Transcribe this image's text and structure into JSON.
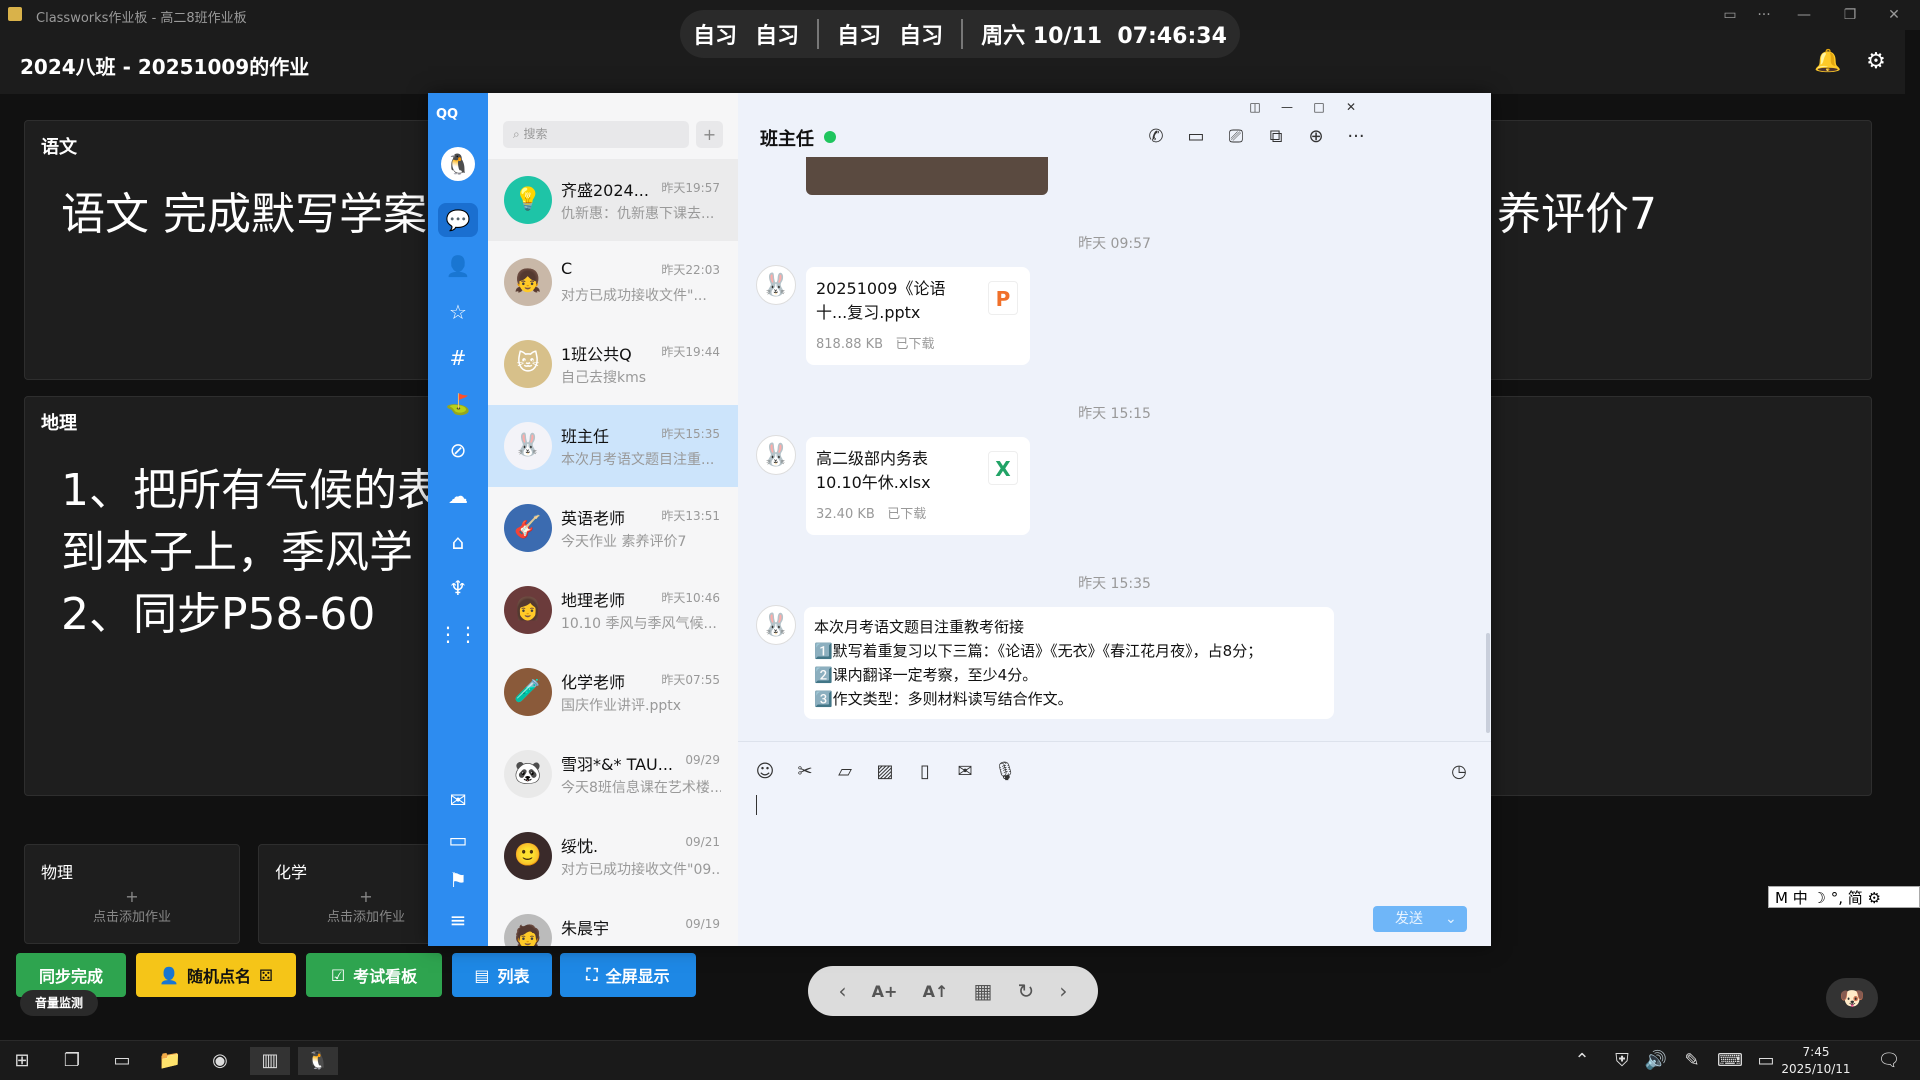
{
  "window": {
    "title": "Classworks作业板 - 高二8班作业板"
  },
  "schedule": {
    "p1": "自习",
    "p2": "自习",
    "p3": "自习",
    "p4": "自习",
    "datetime": "周六 10/11  07:46:34"
  },
  "header": {
    "title": "2024八班 - 20251009的作业"
  },
  "subjects": {
    "chinese": {
      "title": "语文",
      "body": "语文 完成默写学案",
      "body_tail": "养评价7"
    },
    "geo": {
      "title": "地理",
      "line1": "1、把所有气候的表",
      "line2": "到本子上，季风学",
      "line3": "2、同步P58-60"
    },
    "physics": {
      "title": "物理",
      "add": "点击添加作业"
    },
    "chem": {
      "title": "化学",
      "add": "点击添加作业"
    }
  },
  "bottom": {
    "sync": "同步完成",
    "random": "随机点名",
    "exam": "考试看板",
    "list": "列表",
    "fullscreen": "全屏显示",
    "volume": "音量监测"
  },
  "qq": {
    "logo": "QQ",
    "search_placeholder": "搜索",
    "chats": [
      {
        "name": "齐盛2024...",
        "time": "昨天19:57",
        "preview": "仇新惠：仇新惠下课去..."
      },
      {
        "name": "C",
        "time": "昨天22:03",
        "preview": "对方已成功接收文件\"..."
      },
      {
        "name": "1班公共Q",
        "time": "昨天19:44",
        "preview": "自己去搜kms"
      },
      {
        "name": "班主任",
        "time": "昨天15:35",
        "preview": "本次月考语文题目注重..."
      },
      {
        "name": "英语老师",
        "time": "昨天13:51",
        "preview": "今天作业 素养评价7"
      },
      {
        "name": "地理老师",
        "time": "昨天10:46",
        "preview": "10.10 季风与季风气候..."
      },
      {
        "name": "化学老师",
        "time": "昨天07:55",
        "preview": "国庆作业讲评.pptx"
      },
      {
        "name": "雪羽*&* TAU...",
        "time": "09/29",
        "preview": "今天8班信息课在艺术楼..."
      },
      {
        "name": "绥忱.",
        "time": "09/21",
        "preview": "对方已成功接收文件\"09..."
      },
      {
        "name": "朱晨宇",
        "time": "09/19",
        "preview": ""
      }
    ],
    "chat_title": "班主任",
    "ts1": "昨天 09:57",
    "file1": {
      "name": "20251009《论语十...复习.pptx",
      "size": "818.88 KB",
      "status": "已下载"
    },
    "ts2": "昨天 15:15",
    "file2": {
      "name": "高二级部内务表10.10午休.xlsx",
      "size": "32.40 KB",
      "status": "已下载"
    },
    "ts3": "昨天 15:35",
    "message": "本次月考语文题目注重教考衔接\n1️⃣默写着重复习以下三篇：《论语》《无衣》《春江花月夜》，占8分；\n2️⃣课内翻译一定考察，至少4分。\n3️⃣作文类型：多则材料读写结合作文。",
    "send": "发送"
  },
  "taskbar": {
    "time": "7:45",
    "date": "2025/10/11"
  },
  "ime": {
    "text": "M 中 ☽ °, 简 ⚙"
  }
}
